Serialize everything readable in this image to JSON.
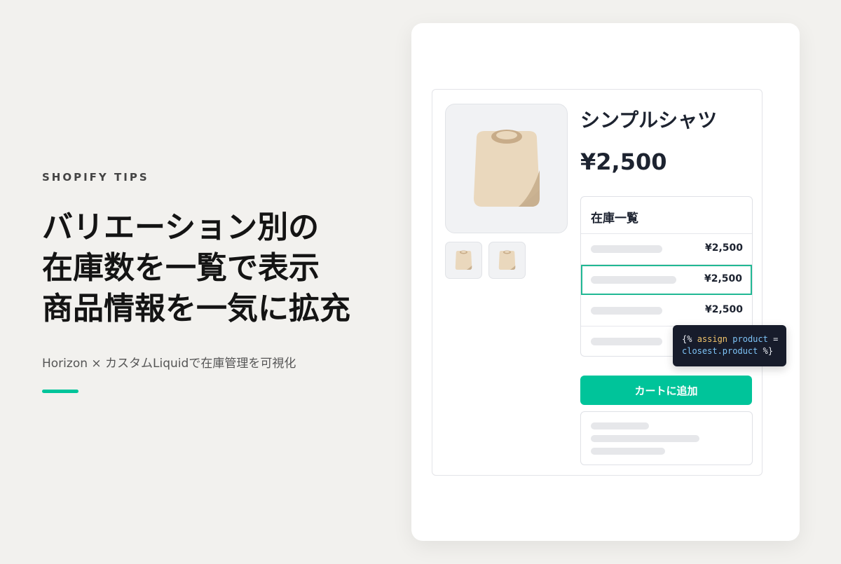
{
  "hero": {
    "eyebrow": "SHOPIFY TIPS",
    "headline_lines": [
      "バリエーション別の",
      "在庫数を一覧で表示",
      "商品情報を一気に拡充"
    ],
    "subtitle": "Horizon × カスタムLiquidで在庫管理を可視化",
    "accent_color": "#00c49a"
  },
  "product": {
    "title": "シンプルシャツ",
    "price": "¥2,500",
    "image_icon": "tshirt-icon",
    "thumbnails": [
      "tshirt-icon",
      "tshirt-icon"
    ]
  },
  "stock_table": {
    "title": "在庫一覧",
    "rows": [
      {
        "price": "¥2,500",
        "selected": false
      },
      {
        "price": "¥2,500",
        "selected": true
      },
      {
        "price": "¥2,500",
        "selected": false
      },
      {
        "price": "",
        "selected": false
      }
    ]
  },
  "code_tooltip": {
    "open": "{%",
    "keyword": "assign",
    "variable": "product",
    "operator": "=",
    "line2_value": "closest.product",
    "close": "%}"
  },
  "cart": {
    "button_label": "カートに追加",
    "button_color": "#00c49a"
  },
  "colors": {
    "background": "#f2f1ee",
    "selected_border": "#21b894",
    "tooltip_bg": "#171c2b"
  }
}
